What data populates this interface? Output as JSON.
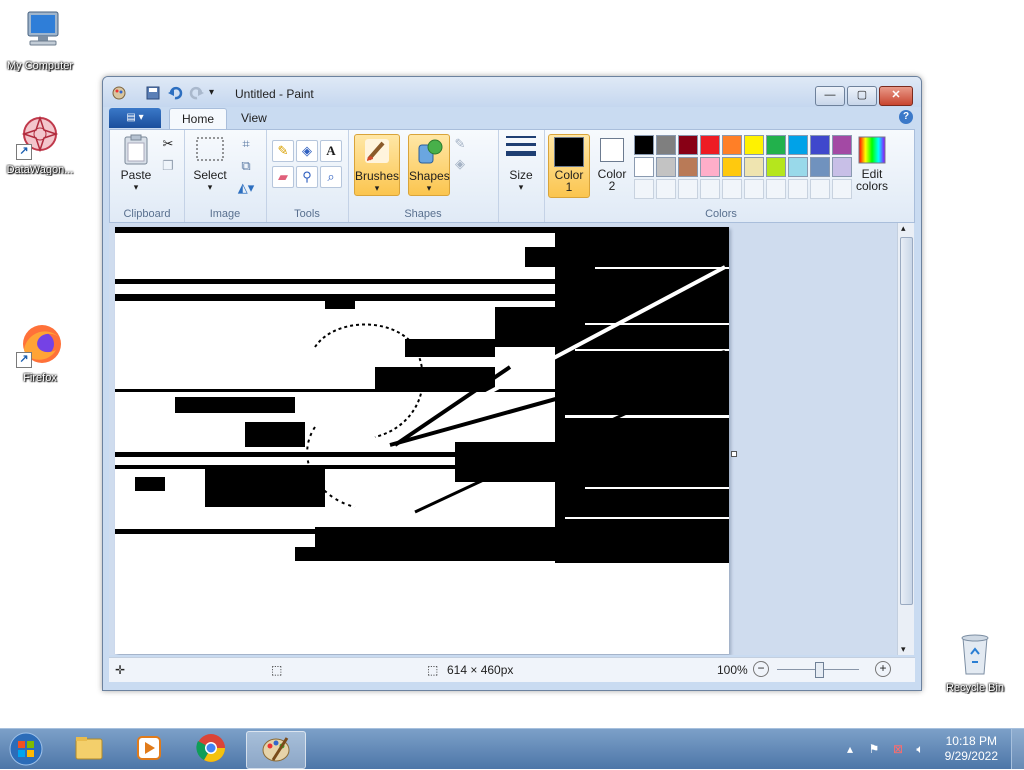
{
  "desktop": {
    "icons": [
      {
        "label": "My Computer"
      },
      {
        "label": "DataWagon..."
      },
      {
        "label": "Firefox"
      },
      {
        "label": "Recycle Bin"
      }
    ]
  },
  "window": {
    "title": "Untitled - Paint",
    "caption_buttons": {
      "minimize": "—",
      "maximize": "▢",
      "close": "✕"
    }
  },
  "ribbon": {
    "tabs": [
      {
        "label": "Home"
      },
      {
        "label": "View"
      }
    ],
    "help": "?",
    "groups": {
      "clipboard": {
        "label": "Clipboard",
        "paste": "Paste"
      },
      "image": {
        "label": "Image",
        "select": "Select"
      },
      "tools": {
        "label": "Tools"
      },
      "shapes": {
        "label": "Shapes",
        "brushes": "Brushes",
        "shapes": "Shapes",
        "size": "Size"
      },
      "colors": {
        "label": "Colors",
        "color1": "Color\n1",
        "color2": "Color\n2",
        "edit_colors": "Edit\ncolors",
        "color1_value": "#000000",
        "color2_value": "#ffffff",
        "palette_row1": [
          "#000000",
          "#7f7f7f",
          "#880015",
          "#ed1c24",
          "#ff7f27",
          "#fff200",
          "#22b14c",
          "#00a2e8",
          "#3f48cc",
          "#a349a4"
        ],
        "palette_row2": [
          "#ffffff",
          "#c3c3c3",
          "#b97a57",
          "#ffaec9",
          "#ffc90e",
          "#efe4b0",
          "#b5e61d",
          "#99d9ea",
          "#7092be",
          "#c8bfe7"
        ]
      }
    }
  },
  "statusbar": {
    "image_size": "614 × 460px",
    "zoom": "100%"
  },
  "taskbar": {
    "clock_time": "10:18 PM",
    "clock_date": "9/29/2022"
  }
}
